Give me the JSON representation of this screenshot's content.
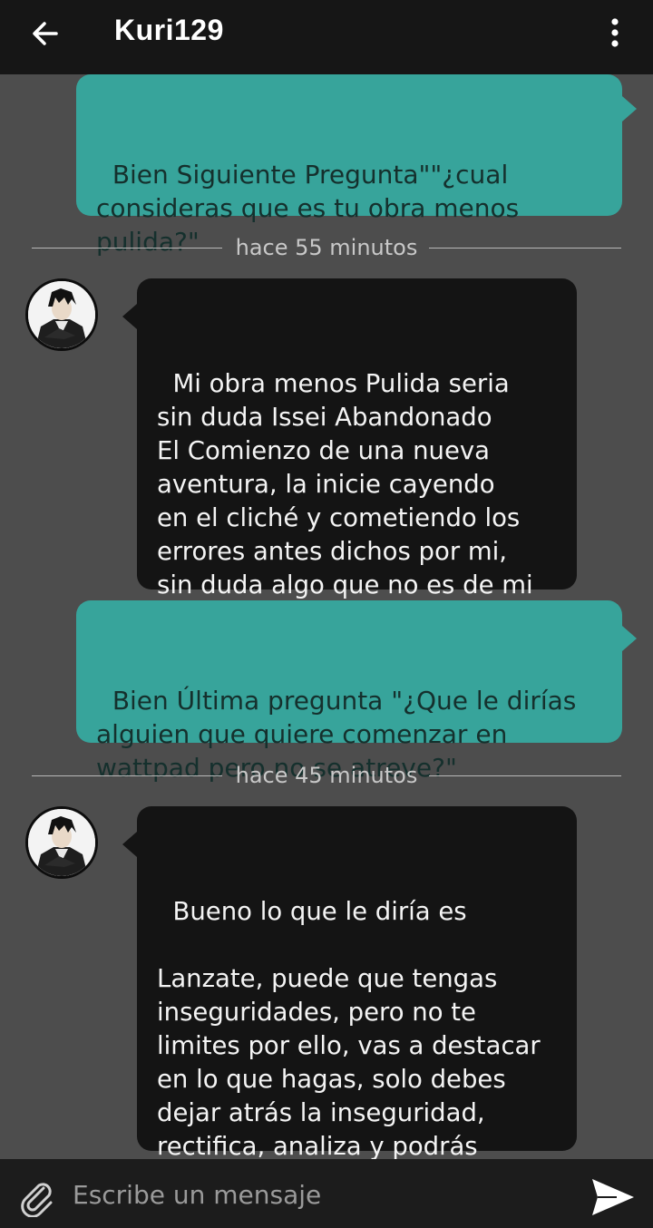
{
  "header": {
    "title": "Kuri129",
    "back_icon": "arrow-left-icon",
    "menu_icon": "more-vertical-icon"
  },
  "messages": [
    {
      "side": "out",
      "text": "Bien Siguiente Pregunta\"\"¿cual\nconsideras que es tu obra menos\npulida?\""
    },
    {
      "side": "divider",
      "text": "hace 55 minutos"
    },
    {
      "side": "in",
      "text": "Mi obra menos Pulida seria\nsin duda Issei Abandonado\nEl Comienzo de una nueva\naventura, la inicie cayendo\nen el cliché y cometiendo los\nerrores antes dichos por mi,\nsin duda algo que no es de mi\nagrado"
    },
    {
      "side": "out",
      "text": "Bien Última pregunta \"¿Que le dirías\nalguien que quiere comenzar en\nwattpad pero no se atreve?\""
    },
    {
      "side": "divider",
      "text": "hace 45 minutos"
    },
    {
      "side": "in",
      "text": "Bueno lo que le diría es\n\nLanzate, puede que tengas\ninseguridades, pero no te\nlimites por ello, vas a destacar\nen lo que hagas, solo debes\ndejar atrás la inseguridad,\nrectifica, analiza y podrás\ndestacar como quieres"
    }
  ],
  "composer": {
    "placeholder": "Escribe un mensaje",
    "attach_icon": "paperclip-icon",
    "send_icon": "send-icon"
  },
  "colors": {
    "background": "#4d4d4d",
    "topbar": "#161616",
    "outgoing_bubble": "#37a49b",
    "incoming_bubble": "#141414",
    "composer": "#1c1c1c"
  }
}
